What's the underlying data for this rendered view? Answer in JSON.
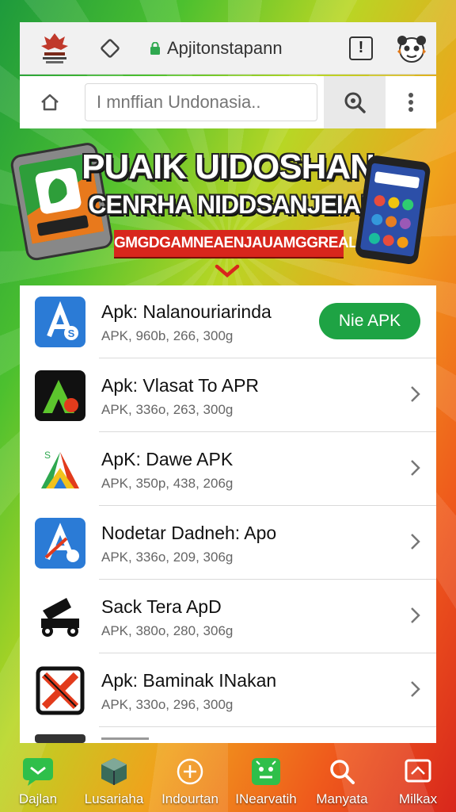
{
  "browser": {
    "url": "Apjitonstapann",
    "search_placeholder": "I mnffian Undonasia..",
    "icons": [
      "logo-emblem",
      "tag-icon",
      "lock-icon",
      "alert-icon",
      "avatar-icon",
      "home-icon",
      "search-icon",
      "more-vert-icon"
    ]
  },
  "banner": {
    "title_line1": "PUAIK UIDOSHAN",
    "title_line2": "CENRHA NIDDSANJEIA!",
    "ribbon": "GMGDGAMNEAENJAUAMGGREAL"
  },
  "apps": [
    {
      "name": "Apk: Nalanouriarinda",
      "meta": "APK, 960b, 266, 300g",
      "action": "Nie APK",
      "icon": "app-store-a-icon"
    },
    {
      "name": "Apk: Vlasat To APR",
      "meta": "APK, 336o, 263, 300g",
      "icon": "green-a-icon"
    },
    {
      "name": "ApK: Dawe APK",
      "meta": "APK, 350p, 438, 206g",
      "icon": "colorful-a-icon"
    },
    {
      "name": "Nodetar Dadneh: Apo",
      "meta": "APK, 336o, 209, 306g",
      "icon": "blue-a-icon"
    },
    {
      "name": "Sack Tera ApD",
      "meta": "APK, 380o, 280, 306g",
      "icon": "cannon-icon"
    },
    {
      "name": "Apk: Baminak INakan",
      "meta": "APK, 330o, 296, 300g",
      "icon": "blocked-icon"
    }
  ],
  "nav": [
    {
      "label": "Dajlan",
      "icon": "chat-icon"
    },
    {
      "label": "Lusariaha",
      "icon": "cube-icon"
    },
    {
      "label": "Indourtan",
      "icon": "plus-circle-icon"
    },
    {
      "label": "INearvatih",
      "icon": "android-icon"
    },
    {
      "label": "Manyata",
      "icon": "search-icon"
    },
    {
      "label": "Milkax",
      "icon": "image-icon"
    }
  ],
  "colors": {
    "accent_green": "#1ea344",
    "ribbon_red": "#d8261c",
    "bar_bg": "#f1f1f1"
  }
}
